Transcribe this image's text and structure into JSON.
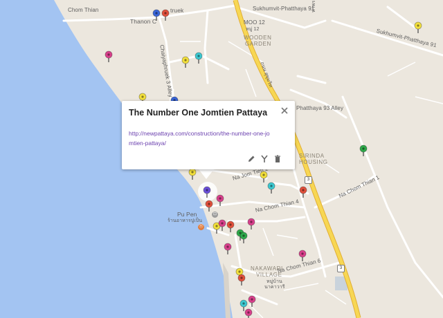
{
  "map": {
    "colors": {
      "land": "#ece7de",
      "water": "#a3c4f2",
      "road_minor": "#ffffff",
      "road_highway": "#f7d754",
      "road_highway_edge": "#e2ae33",
      "pin_yellow": "#f2df3c",
      "pin_blue": "#3a66d8",
      "pin_red": "#e1503c",
      "pin_cyan": "#3cc8d0",
      "pin_pink": "#d8408c",
      "pin_green": "#2ea84a",
      "pin_violet": "#6a4fd8"
    },
    "labels": {
      "thanon_chom": "Chom Thian",
      "thanon_c_truek": "Thanon C",
      "truek": "truek",
      "sukhumvit_91": "Sukhumvit-Phatthaya 91",
      "sukhumvit_91_right": "Sukhumvit-Phatthaya 91",
      "moo12": "MOO 12",
      "moo12_thai": "หมู่ 12",
      "wooden_garden": "WOODEN",
      "wooden_garden_2": "GARDEN",
      "chaiyaphruek_alley": "Chaiyaphruek 3 Alley",
      "sukhumvit_thai": "ถนน สุขุมวิท",
      "phatthaya_93": "Phatthaya 93 Alley",
      "sirinda": "SIRINDA",
      "housing": "HOUSING",
      "jomtien2": "Na Jom Tien 2",
      "chomthian4": "Na Chom Thian 4",
      "chomthian1": "Na Chom Thian 1",
      "chomthian6": "Na Chom Thian 6",
      "pupen": "Pu Pen",
      "pupen_thai": "ร้านอาหารปูเป็น",
      "nakawari": "NAKAWARI",
      "village": "VILLAGE",
      "nakawari_thai": "หมู่บ้าน",
      "nakawari_thai2": "นาคาวารี",
      "thai_top_right": "ท่าพระยา",
      "shield_3": "3",
      "shield_3b": "3"
    },
    "popup": {
      "title": "The Number One Jomtien Pattaya",
      "link": "http://newpattaya.com/construction/the-number-one-jomtien-pattaya/"
    }
  }
}
